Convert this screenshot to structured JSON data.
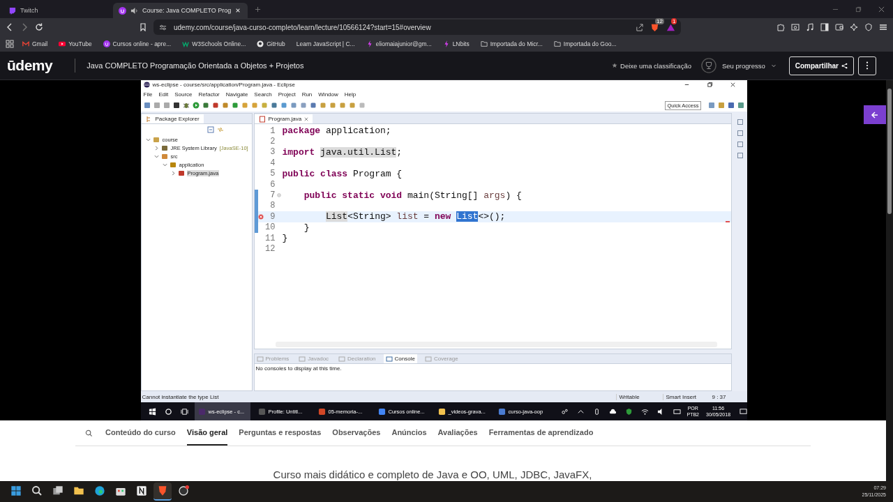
{
  "browser": {
    "tabs": [
      {
        "title": "Twitch",
        "kind": "twitch",
        "selected": false
      },
      {
        "title": "Course: Java COMPLETO Prog",
        "kind": "udemy",
        "selected": true
      }
    ],
    "url": "udemy.com/course/java-curso-completo/learn/lecture/10566124?start=15#overview",
    "shield_badge": "12",
    "rewards_badge": "1",
    "bookmarks": [
      {
        "label": "Gmail",
        "kind": "mail"
      },
      {
        "label": "YouTube",
        "kind": "video"
      },
      {
        "label": "Cursos online - apre...",
        "kind": "udemy"
      },
      {
        "label": "W3Schools Online...",
        "kind": "w3"
      },
      {
        "label": "GitHub",
        "kind": "github"
      },
      {
        "label": "Learn JavaScript | C...",
        "kind": "none"
      },
      {
        "label": "eliomaiajunior@gm...",
        "kind": "bolt"
      },
      {
        "label": "LNbits",
        "kind": "bolt"
      },
      {
        "label": "Importada do Micr...",
        "kind": "folder"
      },
      {
        "label": "Importada do Goo...",
        "kind": "folder"
      }
    ]
  },
  "header": {
    "logo": "ūdemy",
    "course_title": "Java COMPLETO Programação Orientada a Objetos + Projetos",
    "rating_link": "Deixe uma classificação",
    "progress_label": "Seu progresso",
    "share_button": "Compartilhar"
  },
  "video": {
    "eclipse": {
      "title": "ws-eclipse - course/src/application/Program.java - Eclipse",
      "menu": [
        "File",
        "Edit",
        "Source",
        "Refactor",
        "Navigate",
        "Search",
        "Project",
        "Run",
        "Window",
        "Help"
      ],
      "quick_access": "Quick Access",
      "package_explorer": {
        "title": "Package Explorer",
        "tree": [
          {
            "label": "course",
            "kind": "project",
            "expanded": true,
            "selected": false,
            "children": [
              {
                "label": "JRE System Library",
                "decoration": "[JavaSE-10]",
                "kind": "library",
                "expanded": false,
                "selected": false
              },
              {
                "label": "src",
                "kind": "folder",
                "expanded": true,
                "selected": false,
                "children": [
                  {
                    "label": "application",
                    "kind": "package",
                    "expanded": true,
                    "selected": false,
                    "children": [
                      {
                        "label": "Program.java",
                        "kind": "file",
                        "expanded": false,
                        "selected": true
                      }
                    ]
                  }
                ]
              }
            ]
          }
        ]
      },
      "editor": {
        "tab": "Program.java",
        "lines": [
          {
            "number": "1",
            "in_range": false,
            "current": false,
            "error": false,
            "foldable": false,
            "tokens": [
              {
                "text": "package ",
                "kind": "keyword"
              },
              {
                "text": "application;",
                "kind": "plain"
              }
            ]
          },
          {
            "number": "2",
            "in_range": false,
            "current": false,
            "error": false,
            "foldable": false
          },
          {
            "number": "3",
            "in_range": false,
            "current": false,
            "error": false,
            "foldable": false,
            "tokens": [
              {
                "text": "import ",
                "kind": "keyword"
              },
              {
                "text": "java.util.List",
                "kind": "occurrence"
              },
              {
                "text": ";",
                "kind": "plain"
              }
            ]
          },
          {
            "number": "4",
            "in_range": false,
            "current": false,
            "error": false,
            "foldable": false
          },
          {
            "number": "5",
            "in_range": false,
            "current": false,
            "error": false,
            "foldable": false,
            "tokens": [
              {
                "text": "public class ",
                "kind": "keyword"
              },
              {
                "text": "Program {",
                "kind": "plain"
              }
            ]
          },
          {
            "number": "6",
            "in_range": false,
            "current": false,
            "error": false,
            "foldable": false
          },
          {
            "number": "7",
            "in_range": true,
            "current": false,
            "error": false,
            "foldable": true,
            "tokens": [
              {
                "text": "public static void ",
                "kind": "keyword"
              },
              {
                "text": "main(String[] ",
                "kind": "plain"
              },
              {
                "text": "args",
                "kind": "variable"
              },
              {
                "text": ") {",
                "kind": "plain"
              }
            ]
          },
          {
            "number": "8",
            "in_range": true,
            "current": false,
            "error": false,
            "foldable": false
          },
          {
            "number": "9",
            "in_range": true,
            "current": true,
            "error": true,
            "foldable": false,
            "tokens": [
              {
                "text": "List",
                "kind": "occurrence"
              },
              {
                "text": "<String> ",
                "kind": "plain"
              },
              {
                "text": "list",
                "kind": "variable"
              },
              {
                "text": " = ",
                "kind": "plain"
              },
              {
                "text": "new ",
                "kind": "keyword"
              },
              {
                "text": "List",
                "kind": "selected"
              },
              {
                "text": "<>();",
                "kind": "plain"
              }
            ]
          },
          {
            "number": "10",
            "in_range": true,
            "current": false,
            "error": false,
            "foldable": false,
            "tokens": [
              {
                "text": "}",
                "kind": "plain"
              }
            ]
          },
          {
            "number": "11",
            "in_range": false,
            "current": false,
            "error": false,
            "foldable": false,
            "tokens": [
              {
                "text": "}",
                "kind": "plain"
              }
            ]
          },
          {
            "number": "12",
            "in_range": false,
            "current": false,
            "error": false,
            "foldable": false
          }
        ]
      },
      "console": {
        "tabs": [
          {
            "label": "Problems",
            "selected": false
          },
          {
            "label": "Javadoc",
            "selected": false
          },
          {
            "label": "Declaration",
            "selected": false
          },
          {
            "label": "Console",
            "selected": true
          },
          {
            "label": "Coverage",
            "selected": false
          }
        ],
        "message": "No consoles to display at this time."
      },
      "status_bar": {
        "message": "Cannot instantiate the type List",
        "mode": "Writable",
        "insert_mode": "Smart Insert",
        "position": "9 : 37"
      },
      "taskbar": {
        "items": [
          {
            "label": "ws-eclipse - c...",
            "kind": "eclipse",
            "selected": true
          },
          {
            "label": "Profile: Untitl...",
            "kind": "profiler",
            "selected": false
          },
          {
            "label": "05-memoria-...",
            "kind": "slides",
            "selected": false
          },
          {
            "label": "Cursos online...",
            "kind": "chrome",
            "selected": false
          },
          {
            "label": "_videos-grava...",
            "kind": "folder",
            "selected": false
          },
          {
            "label": "curso-java-oop",
            "kind": "document",
            "selected": false
          }
        ],
        "language": "POR",
        "layout": "PTB2",
        "time": "11:56",
        "date": "30/05/2018"
      }
    }
  },
  "course_tabs": [
    {
      "label": "Conteúdo do curso",
      "selected": false
    },
    {
      "label": "Visão geral",
      "selected": true
    },
    {
      "label": "Perguntas e respostas",
      "selected": false
    },
    {
      "label": "Observações",
      "selected": false
    },
    {
      "label": "Anúncios",
      "selected": false
    },
    {
      "label": "Avaliações",
      "selected": false
    },
    {
      "label": "Ferramentas de aprendizado",
      "selected": false
    }
  ],
  "description": "Curso mais didático e completo de Java e OO, UML, JDBC, JavaFX,",
  "os_taskbar": {
    "apps": [
      {
        "kind": "start",
        "selected": false
      },
      {
        "kind": "search",
        "selected": false
      },
      {
        "kind": "taskview",
        "selected": false
      },
      {
        "kind": "folder",
        "selected": false
      },
      {
        "kind": "edge",
        "selected": false
      },
      {
        "kind": "store",
        "selected": false
      },
      {
        "kind": "notion",
        "selected": false
      },
      {
        "kind": "brave",
        "selected": true
      },
      {
        "kind": "obs",
        "selected": false
      }
    ],
    "time": "07:29",
    "date": "25/11/2025"
  }
}
